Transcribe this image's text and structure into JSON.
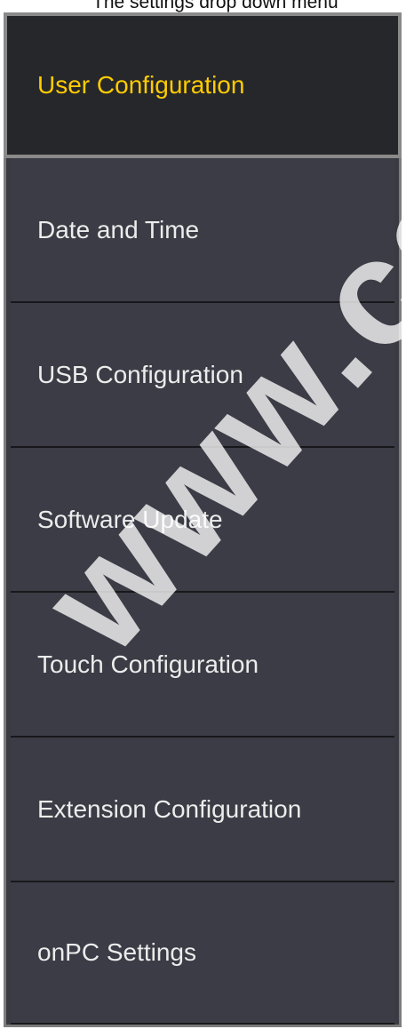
{
  "caption": "The settings drop down menu",
  "menu": {
    "items": [
      {
        "label": "User Configuration",
        "active": true
      },
      {
        "label": "Date and Time",
        "active": false
      },
      {
        "label": "USB Configuration",
        "active": false
      },
      {
        "label": "Software Update",
        "active": false
      },
      {
        "label": "Touch Configuration",
        "active": false
      },
      {
        "label": "Extension Configuration",
        "active": false
      },
      {
        "label": "onPC Settings",
        "active": false
      }
    ]
  },
  "colors": {
    "menu_background": "#3b3c45",
    "active_background": "#26272b",
    "active_text": "#ffcc00",
    "text": "#ececec",
    "border": "#8a8a8a",
    "separator": "#18181b"
  },
  "watermark": "www.carlo"
}
